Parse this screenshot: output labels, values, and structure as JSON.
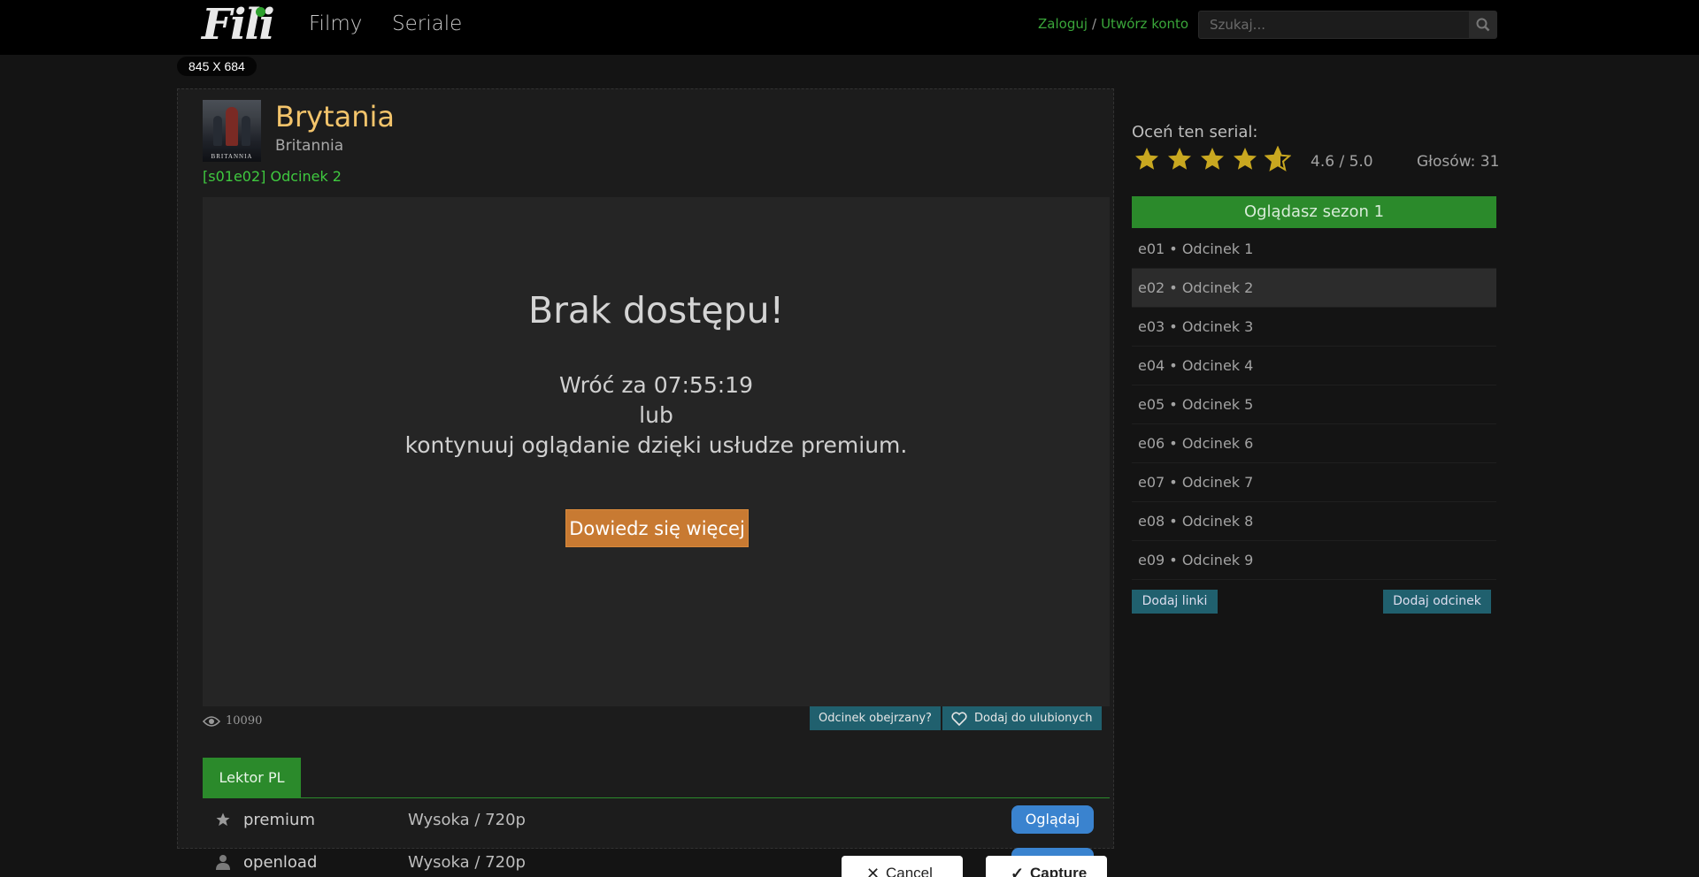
{
  "header": {
    "logo": "Fili",
    "nav": {
      "films": "Filmy",
      "series": "Seriale"
    },
    "login": "Zaloguj",
    "separator": "/",
    "register": "Utwórz konto",
    "search_placeholder": "Szukaj..."
  },
  "size_badge": "845 X 684",
  "show": {
    "title": "Brytania",
    "original_title": "Britannia",
    "poster_text": "BRITANNIA",
    "episode_label": "[s01e02] Odcinek 2"
  },
  "player": {
    "heading": "Brak dostępu!",
    "line1": "Wróć za 07:55:19",
    "line2": "lub",
    "line3": "kontynuuj oglądanie dzięki usłudze premium.",
    "button": "Dowiedz się więcej"
  },
  "views": "10090",
  "actions": {
    "watched": "Odcinek obejrzany?",
    "favorite": "Dodaj do ulubionych"
  },
  "tab": "Lektor PL",
  "sources": [
    {
      "name": "premium",
      "quality": "Wysoka / 720p",
      "icon": "star-icon",
      "button": "Oglądaj"
    },
    {
      "name": "openload",
      "quality": "Wysoka / 720p",
      "icon": "user-icon",
      "button": ""
    }
  ],
  "sidebar": {
    "rate_label": "Oceń ten serial:",
    "rating": "4.6 / 5.0",
    "rating_value": 4.6,
    "votes": "Głosów: 31",
    "season": "Oglądasz sezon 1",
    "episodes": [
      "e01 • Odcinek 1",
      "e02 • Odcinek 2",
      "e03 • Odcinek 3",
      "e04 • Odcinek 4",
      "e05 • Odcinek 5",
      "e06 • Odcinek 6",
      "e07 • Odcinek 7",
      "e08 • Odcinek 8",
      "e09 • Odcinek 9"
    ],
    "add_links": "Dodaj linki",
    "add_episode": "Dodaj odcinek"
  },
  "capture": {
    "cancel": "Cancel",
    "capture": "Capture"
  },
  "colors": {
    "accent_green": "#2b8a2b",
    "title_gold": "#f3c46b",
    "teal": "#20606e",
    "orange": "#c87a32",
    "blue": "#3a83cf",
    "star": "#c9a820"
  }
}
